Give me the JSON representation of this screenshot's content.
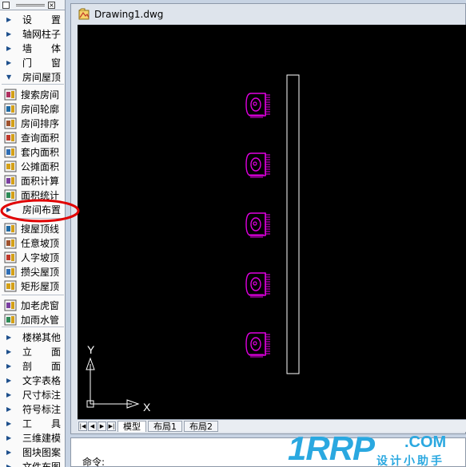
{
  "palette": {
    "items": [
      {
        "label": "设置",
        "arrow": "▶",
        "icon": "",
        "spread": true
      },
      {
        "label": "轴网柱子",
        "arrow": "▶",
        "icon": ""
      },
      {
        "label": "墙体",
        "arrow": "▶",
        "icon": "",
        "spread": true
      },
      {
        "label": "门窗",
        "arrow": "▶",
        "icon": "",
        "spread": true
      },
      {
        "label": "房间屋顶",
        "arrow": "▼",
        "icon": ""
      },
      {
        "label": "搜索房间",
        "arrow": "",
        "icon": "search-room-icon"
      },
      {
        "label": "房间轮廓",
        "arrow": "",
        "icon": "room-outline-icon"
      },
      {
        "label": "房间排序",
        "arrow": "",
        "icon": "room-sort-icon"
      },
      {
        "label": "查询面积",
        "arrow": "",
        "icon": "query-area-icon"
      },
      {
        "label": "套内面积",
        "arrow": "",
        "icon": "inner-area-icon"
      },
      {
        "label": "公摊面积",
        "arrow": "",
        "icon": "shared-area-icon"
      },
      {
        "label": "面积计算",
        "arrow": "",
        "icon": "area-calc-icon"
      },
      {
        "label": "面积统计",
        "arrow": "",
        "icon": "area-stats-icon"
      },
      {
        "label": "房间布置",
        "arrow": "▶",
        "icon": "",
        "group": true
      },
      {
        "label": "搜屋顶线",
        "arrow": "",
        "icon": "roof-line-icon"
      },
      {
        "label": "任意坡顶",
        "arrow": "",
        "icon": "any-slope-icon"
      },
      {
        "label": "人字坡顶",
        "arrow": "",
        "icon": "gable-roof-icon"
      },
      {
        "label": "攒尖屋顶",
        "arrow": "",
        "icon": "pyramid-roof-icon"
      },
      {
        "label": "矩形屋顶",
        "arrow": "",
        "icon": "rect-roof-icon"
      },
      {
        "label": "加老虎窗",
        "arrow": "",
        "icon": "dormer-icon"
      },
      {
        "label": "加雨水管",
        "arrow": "",
        "icon": "downpipe-icon"
      },
      {
        "label": "楼梯其他",
        "arrow": "▶",
        "icon": ""
      },
      {
        "label": "立面",
        "arrow": "▶",
        "icon": "",
        "spread": true
      },
      {
        "label": "剖面",
        "arrow": "▶",
        "icon": "",
        "spread": true
      },
      {
        "label": "文字表格",
        "arrow": "▶",
        "icon": ""
      },
      {
        "label": "尺寸标注",
        "arrow": "▶",
        "icon": ""
      },
      {
        "label": "符号标注",
        "arrow": "▶",
        "icon": ""
      },
      {
        "label": "工具",
        "arrow": "▶",
        "icon": "",
        "spread": true
      },
      {
        "label": "三维建模",
        "arrow": "▶",
        "icon": ""
      },
      {
        "label": "图块图案",
        "arrow": "▶",
        "icon": ""
      },
      {
        "label": "文件布图",
        "arrow": "▶",
        "icon": ""
      }
    ]
  },
  "document": {
    "title": "Drawing1.dwg",
    "icon": "dwg-file-icon"
  },
  "canvas": {
    "background": "#000000",
    "entity_color": "#e000e0",
    "wall_color": "#ffffff",
    "axis_x_label": "X",
    "axis_y_label": "Y"
  },
  "tabs": {
    "nav": [
      "|◀",
      "◀",
      "▶",
      "▶|"
    ],
    "items": [
      {
        "label": "模型",
        "active": true
      },
      {
        "label": "布局1",
        "active": false
      },
      {
        "label": "布局2",
        "active": false
      }
    ]
  },
  "command": {
    "prompt": "命令:"
  },
  "highlight": {
    "color": "#e00000",
    "target": "房间布置"
  },
  "watermark": {
    "brand": "1RRP",
    "suffix": ".COM",
    "tagline": "设计小助手",
    "color": "#2aa8e0"
  }
}
